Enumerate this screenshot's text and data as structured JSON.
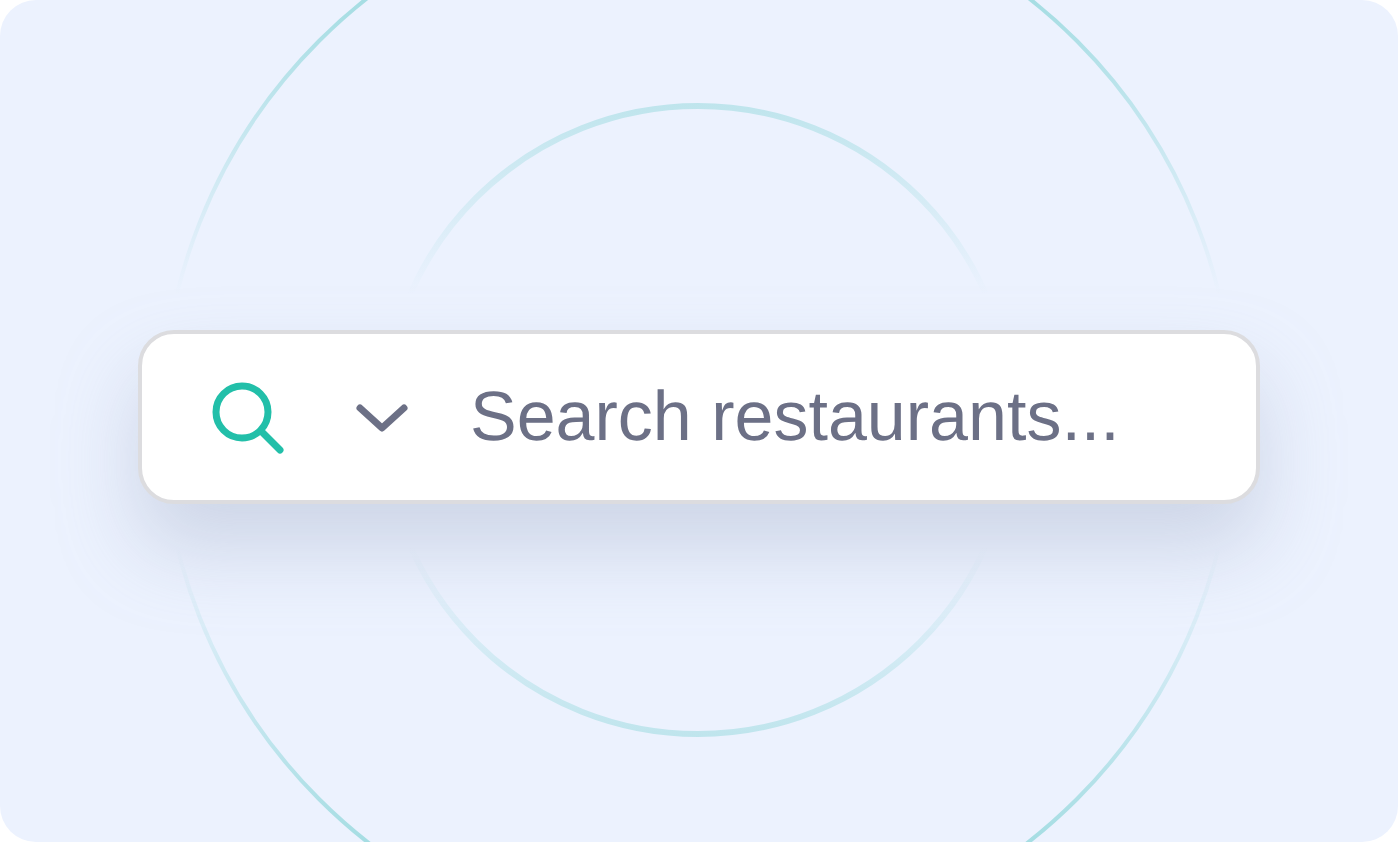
{
  "search": {
    "placeholder": "Search restaurants..."
  }
}
